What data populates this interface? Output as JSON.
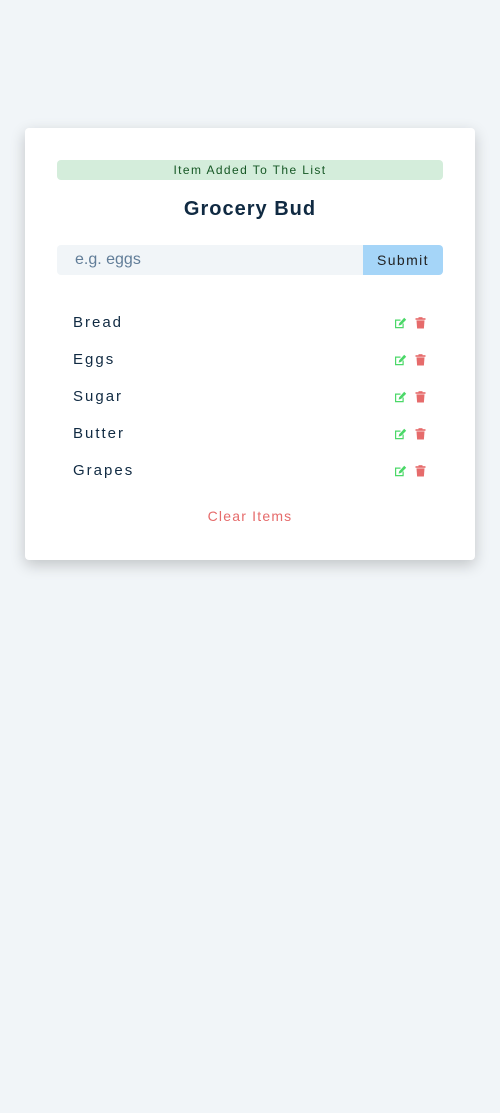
{
  "alert": {
    "text": "Item Added To The List"
  },
  "title": "Grocery Bud",
  "form": {
    "placeholder": "e.g. eggs",
    "value": "",
    "submit_label": "Submit"
  },
  "items": [
    {
      "title": "Bread"
    },
    {
      "title": "Eggs"
    },
    {
      "title": "Sugar"
    },
    {
      "title": "Butter"
    },
    {
      "title": "Grapes"
    }
  ],
  "icons": {
    "edit": "edit-icon",
    "delete": "trash-icon"
  },
  "colors": {
    "background": "#f1f5f8",
    "alert_bg": "#d4eddb",
    "alert_text": "#155724",
    "title": "#102a42",
    "submit_bg": "#a5d5f8",
    "edit": "#4bd868",
    "delete": "#e66b6b",
    "clear": "#e66b6b"
  },
  "clear_label": "Clear Items"
}
